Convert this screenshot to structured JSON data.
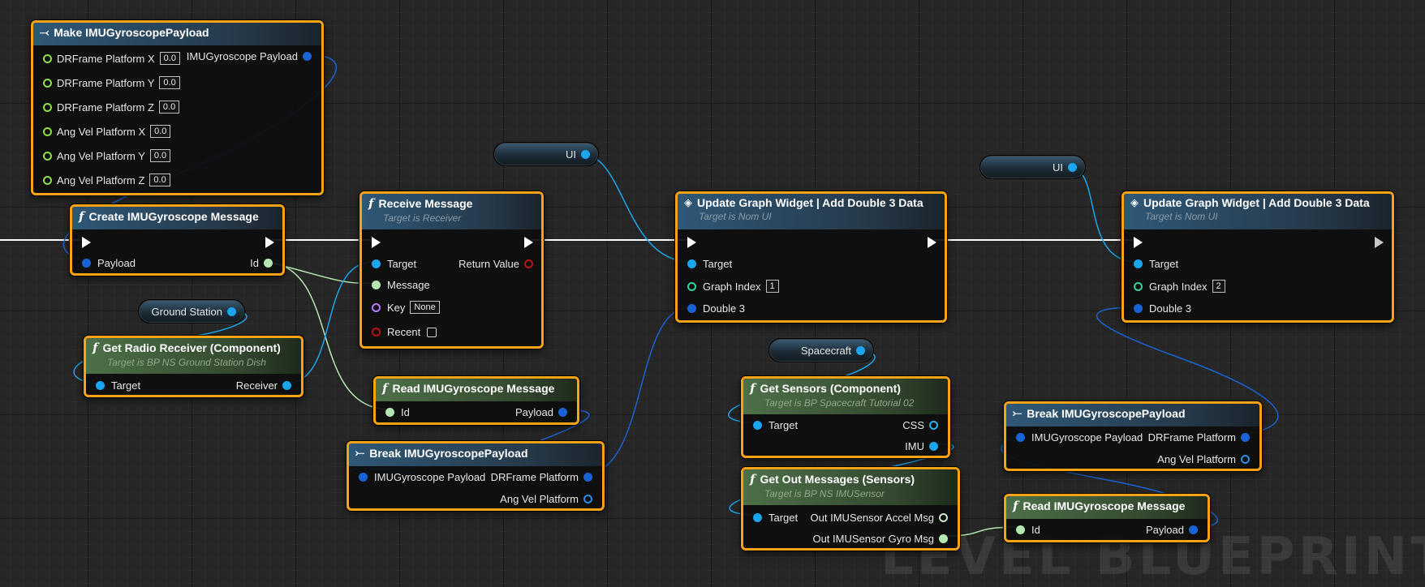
{
  "watermark": "LEVEL BLUEPRINT",
  "make_payload": {
    "title": "Make IMUGyroscopePayload",
    "inputs": [
      {
        "label": "DRFrame Platform X",
        "value": "0.0"
      },
      {
        "label": "DRFrame Platform Y",
        "value": "0.0"
      },
      {
        "label": "DRFrame Platform Z",
        "value": "0.0"
      },
      {
        "label": "Ang Vel Platform X",
        "value": "0.0"
      },
      {
        "label": "Ang Vel Platform Y",
        "value": "0.0"
      },
      {
        "label": "Ang Vel Platform Z",
        "value": "0.0"
      }
    ],
    "output": "IMUGyroscope Payload"
  },
  "create_msg": {
    "title": "Create IMUGyroscope Message",
    "payload": "Payload",
    "id": "Id"
  },
  "ground_station_var": {
    "label": "Ground Station"
  },
  "get_radio": {
    "title": "Get Radio Receiver (Component)",
    "subtitle": "Target is BP NS Ground Station Dish",
    "target": "Target",
    "receiver": "Receiver"
  },
  "receive_msg": {
    "title": "Receive Message",
    "subtitle": "Target is Receiver",
    "target": "Target",
    "return_value": "Return Value",
    "message": "Message",
    "key": "Key",
    "key_value": "None",
    "recent": "Recent"
  },
  "read_msg_1": {
    "title": "Read IMUGyroscope Message",
    "id": "Id",
    "payload": "Payload"
  },
  "break_payload_1": {
    "title": "Break IMUGyroscopePayload",
    "input": "IMUGyroscope Payload",
    "out1": "DRFrame Platform",
    "out2": "Ang Vel Platform"
  },
  "ui_var_1": {
    "label": "UI"
  },
  "update_graph_1": {
    "title": "Update Graph Widget  |  Add Double 3 Data",
    "subtitle": "Target is Nom UI",
    "target": "Target",
    "graph_index": "Graph Index",
    "graph_index_value": "1",
    "double3": "Double 3"
  },
  "spacecraft_var": {
    "label": "Spacecraft"
  },
  "get_sensors": {
    "title": "Get Sensors (Component)",
    "subtitle": "Target is BP Spacecraft Tutorial 02",
    "target": "Target",
    "css": "CSS",
    "imu": "IMU"
  },
  "get_out_messages": {
    "title": "Get Out Messages (Sensors)",
    "subtitle": "Target is BP NS IMUSensor",
    "target": "Target",
    "accel": "Out IMUSensor Accel Msg",
    "gyro": "Out IMUSensor Gyro Msg"
  },
  "ui_var_2": {
    "label": "UI"
  },
  "update_graph_2": {
    "title": "Update Graph Widget  |  Add Double 3 Data",
    "subtitle": "Target is Nom UI",
    "target": "Target",
    "graph_index": "Graph Index",
    "graph_index_value": "2",
    "double3": "Double 3"
  },
  "break_payload_2": {
    "title": "Break IMUGyroscopePayload",
    "input": "IMUGyroscope Payload",
    "out1": "DRFrame Platform",
    "out2": "Ang Vel Platform"
  },
  "read_msg_2": {
    "title": "Read IMUGyroscope Message",
    "id": "Id",
    "payload": "Payload"
  },
  "colors": {
    "selection": "#f7a315",
    "exec_wire": "#ffffff",
    "object_wire": "#1aa5ee",
    "struct_wire": "#1a63d4",
    "message_wire": "#b5e8b0"
  },
  "icons": {
    "function": "function-icon",
    "make_struct": "make-struct-icon",
    "break_struct": "break-struct-icon",
    "interface_call": "interface-call-icon"
  }
}
